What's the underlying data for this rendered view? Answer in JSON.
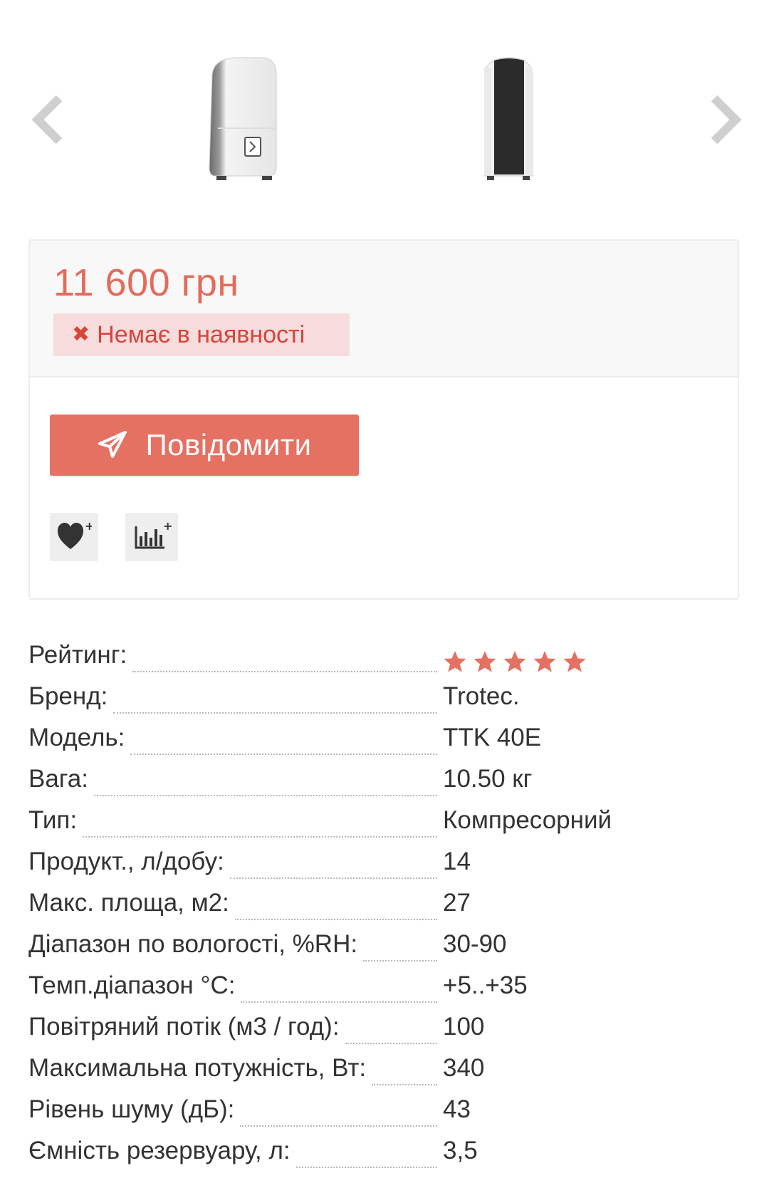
{
  "price": "11 600 грн",
  "stock_status": "Немає в наявності",
  "notify_label": "Повідомити",
  "colors": {
    "accent": "#e57163",
    "price": "#e46b5b",
    "out_of_stock": "#d9433b",
    "badge_bg": "#f6dcdc"
  },
  "icons": [
    "chevron-left-icon",
    "chevron-right-icon",
    "x-icon",
    "paper-plane-icon",
    "heart-plus-icon",
    "chart-plus-icon",
    "star-icon"
  ],
  "specs": [
    {
      "label": "Рейтинг:",
      "value": "",
      "rating": 5
    },
    {
      "label": "Бренд:",
      "value": "Trotec."
    },
    {
      "label": "Модель:",
      "value": "TTK 40E"
    },
    {
      "label": "Вага:",
      "value": "10.50 кг"
    },
    {
      "label": "Тип:",
      "value": "Компресорний"
    },
    {
      "label": "Продукт., л/добу:",
      "value": "14"
    },
    {
      "label": "Макс. площа, м2:",
      "value": "27"
    },
    {
      "label": "Діапазон по вологості, %RH:",
      "value": "30-90"
    },
    {
      "label": "Темп.діапазон °С:",
      "value": "+5..+35"
    },
    {
      "label": "Повітряний потік (м3 / год):",
      "value": "100"
    },
    {
      "label": "Максимальна потужність, Вт:",
      "value": "340"
    },
    {
      "label": "Рівень шуму (дБ):",
      "value": "43"
    },
    {
      "label": "Ємність резервуару, л:",
      "value": "3,5"
    }
  ]
}
